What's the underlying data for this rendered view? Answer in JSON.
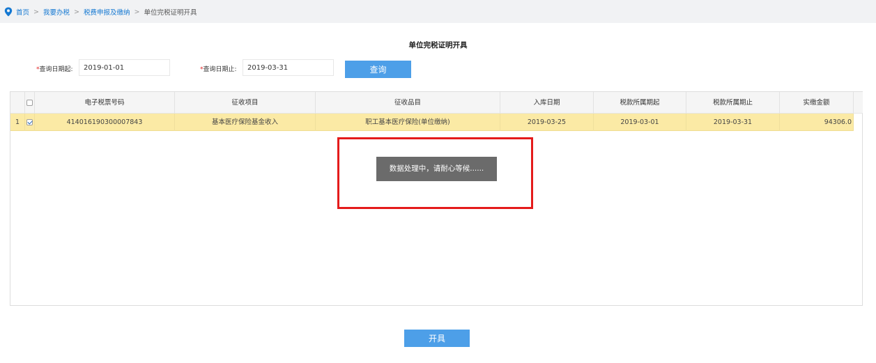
{
  "breadcrumb": {
    "items": [
      "首页",
      "我要办税",
      "税费申报及缴纳"
    ],
    "separator": ">",
    "current": "单位完税证明开具"
  },
  "page_title": "单位完税证明开具",
  "query": {
    "start_label": "查询日期起:",
    "start_value": "2019-01-01",
    "end_label": "查询日期止:",
    "end_value": "2019-03-31",
    "required_mark": "*",
    "search_label": "查询"
  },
  "table": {
    "columns": [
      "电子税票号码",
      "征收项目",
      "征收品目",
      "入库日期",
      "税款所属期起",
      "税款所属期止",
      "实缴金额"
    ],
    "rows": [
      {
        "index": "1",
        "checked": true,
        "cells": [
          "414016190300007843",
          "基本医疗保险基金收入",
          "职工基本医疗保险(单位缴纳)",
          "2019-03-25",
          "2019-03-01",
          "2019-03-31",
          "94306.0"
        ]
      }
    ]
  },
  "loading_message": "数据处理中，请耐心等候......",
  "issue_button": "开具",
  "colors": {
    "accent": "#4d9fe8",
    "link": "#1478d2",
    "selected_row": "#fbeaa5",
    "highlight_border": "#e41b1b",
    "toast_bg": "#6b6b6b"
  },
  "icons": {
    "breadcrumb": "location-pin-icon",
    "header_checkbox": "checkbox-icon",
    "row_checkbox": "checkbox-checked-icon"
  }
}
